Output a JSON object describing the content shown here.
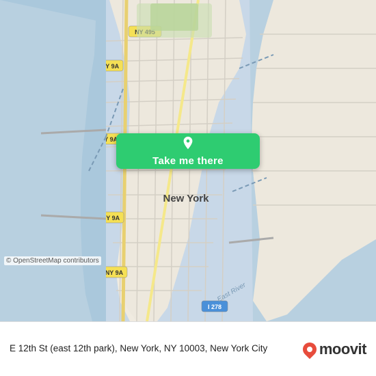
{
  "map": {
    "attribution": "© OpenStreetMap contributors",
    "center_label": "New York"
  },
  "button": {
    "label": "Take me there",
    "pin_icon": "📍"
  },
  "bottom_bar": {
    "location_text": "E 12th St (east 12th park), New York, NY 10003, New York City",
    "moovit_label": "moovit"
  }
}
